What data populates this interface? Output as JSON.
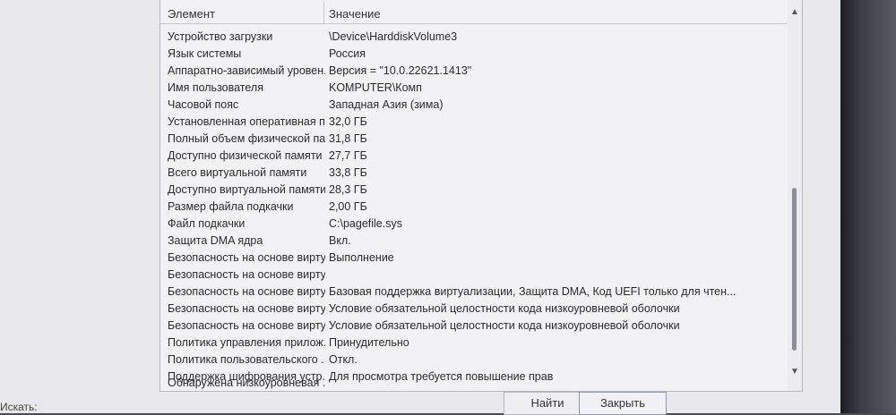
{
  "columns": {
    "item": "Элемент",
    "value": "Значение"
  },
  "rows": [
    {
      "name": "Устройство загрузки",
      "value": "\\Device\\HarddiskVolume3"
    },
    {
      "name": "Язык системы",
      "value": "Россия"
    },
    {
      "name": "Аппаратно-зависимый уровен...",
      "value": "Версия = \"10.0.22621.1413\""
    },
    {
      "name": "Имя пользователя",
      "value": "KOMPUTER\\Комп"
    },
    {
      "name": "Часовой пояс",
      "value": "Западная Азия (зима)"
    },
    {
      "name": "Установленная оперативная п...",
      "value": "32,0 ГБ"
    },
    {
      "name": "Полный объем физической па...",
      "value": "31,8 ГБ"
    },
    {
      "name": "Доступно физической памяти",
      "value": "27,7 ГБ"
    },
    {
      "name": "Всего виртуальной памяти",
      "value": "33,8 ГБ"
    },
    {
      "name": "Доступно виртуальной памяти",
      "value": "28,3 ГБ"
    },
    {
      "name": "Размер файла подкачки",
      "value": "2,00 ГБ"
    },
    {
      "name": "Файл подкачки",
      "value": "C:\\pagefile.sys"
    },
    {
      "name": "Защита DMA ядра",
      "value": "Вкл."
    },
    {
      "name": "Безопасность на основе вирту...",
      "value": "Выполнение"
    },
    {
      "name": "Безопасность на основе вирту...",
      "value": ""
    },
    {
      "name": "Безопасность на основе вирту...",
      "value": "Базовая поддержка виртуализации, Защита DMA, Код UEFI только для чтен..."
    },
    {
      "name": "Безопасность на основе вирту...",
      "value": "Условие обязательной целостности кода низкоуровневой оболочки"
    },
    {
      "name": "Безопасность на основе вирту...",
      "value": "Условие обязательной целостности кода низкоуровневой оболочки"
    },
    {
      "name": "Политика управления прилож...",
      "value": "Принудительно"
    },
    {
      "name": "Политика пользовательского ...",
      "value": "Откл."
    },
    {
      "name": "Поддержка шифрования устр...",
      "value": "Для просмотра требуется повышение прав"
    },
    {
      "name": "Обнаружена низкоуровневая ...",
      "value": ""
    }
  ],
  "buttons": {
    "find": "Найти",
    "close": "Закрыть"
  },
  "search": {
    "label": "Искать:"
  },
  "scrollbar": {
    "position_fraction": 0.9
  },
  "icons": {
    "scroll_up": "chevron-up-icon",
    "scroll_down": "chevron-down-icon"
  }
}
